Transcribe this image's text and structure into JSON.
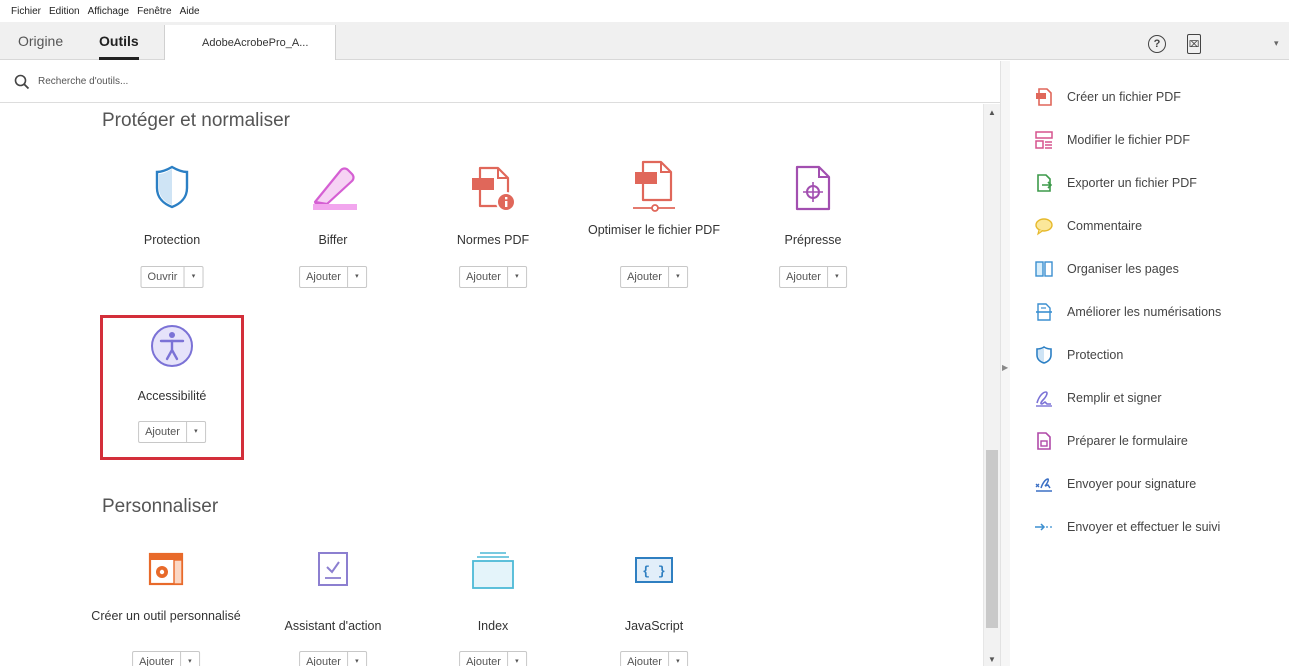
{
  "menu": [
    "Fichier",
    "Edition",
    "Affichage",
    "Fenêtre",
    "Aide"
  ],
  "tabs": {
    "origine": "Origine",
    "outils": "Outils",
    "document": "AdobeAcrobePro_A..."
  },
  "toolbar": {
    "help_glyph": "?",
    "mobile_glyph": "⌧",
    "chevron": "▾"
  },
  "search": {
    "placeholder": "Recherche d'outils..."
  },
  "sections": {
    "protect": {
      "title": "Protéger et normaliser",
      "tools": [
        {
          "name": "Protection",
          "button": "Ouvrir",
          "icon": "shield-icon"
        },
        {
          "name": "Biffer",
          "button": "Ajouter",
          "icon": "redact-icon"
        },
        {
          "name": "Normes PDF",
          "button": "Ajouter",
          "icon": "pdf-standards-icon"
        },
        {
          "name": "Optimiser le fichier PDF",
          "button": "Ajouter",
          "icon": "optimize-pdf-icon"
        },
        {
          "name": "Prépresse",
          "button": "Ajouter",
          "icon": "prepress-icon"
        },
        {
          "name": "Accessibilité",
          "button": "Ajouter",
          "icon": "accessibility-icon"
        }
      ]
    },
    "custom": {
      "title": "Personnaliser",
      "tools": [
        {
          "name": "Créer un outil personnalisé",
          "button": "Ajouter",
          "icon": "custom-tool-icon"
        },
        {
          "name": "Assistant d'action",
          "button": "Ajouter",
          "icon": "action-wizard-icon"
        },
        {
          "name": "Index",
          "button": "Ajouter",
          "icon": "index-icon"
        },
        {
          "name": "JavaScript",
          "button": "Ajouter",
          "icon": "javascript-icon"
        }
      ]
    }
  },
  "caret": "▾",
  "scroll": {
    "up": "▲",
    "down": "▼"
  },
  "splitter": {
    "arrow": "▶"
  },
  "right_panel": [
    {
      "label": "Créer un fichier PDF",
      "icon": "create-pdf-icon"
    },
    {
      "label": "Modifier le fichier PDF",
      "icon": "edit-pdf-icon"
    },
    {
      "label": "Exporter un fichier PDF",
      "icon": "export-pdf-icon"
    },
    {
      "label": "Commentaire",
      "icon": "comment-icon"
    },
    {
      "label": "Organiser les pages",
      "icon": "organize-pages-icon"
    },
    {
      "label": "Améliorer les numérisations",
      "icon": "enhance-scans-icon"
    },
    {
      "label": "Protection",
      "icon": "shield-icon"
    },
    {
      "label": "Remplir et signer",
      "icon": "fill-sign-icon"
    },
    {
      "label": "Préparer le formulaire",
      "icon": "prepare-form-icon"
    },
    {
      "label": "Envoyer pour signature",
      "icon": "send-signature-icon"
    },
    {
      "label": "Envoyer et effectuer le suivi",
      "icon": "send-track-icon"
    }
  ],
  "colors": {
    "highlight": "#d32f3a",
    "shield": "#2b7fc4",
    "redact": "#d55fd3",
    "pdf_red": "#e0675a",
    "prepress": "#a24fb0",
    "accessibility": "#7b72d6",
    "custom_tool": "#e86a2a",
    "action_wizard": "#8c7fd0",
    "index_teal": "#4cb9d6",
    "javascript": "#2f7fc1"
  }
}
